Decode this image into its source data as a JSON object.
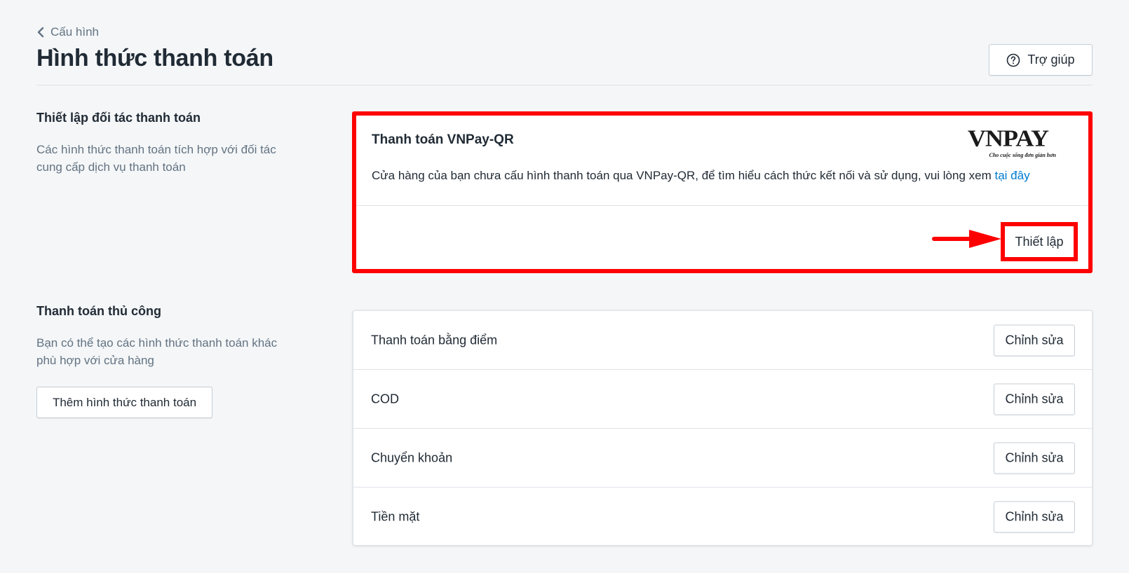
{
  "breadcrumb": {
    "label": "Cấu hình",
    "icon": "chevron-left-icon"
  },
  "page": {
    "title": "Hình thức thanh toán"
  },
  "help_button": {
    "label": "Trợ giúp",
    "icon": "question-circle-icon"
  },
  "partner_section": {
    "title": "Thiết lập đối tác thanh toán",
    "description": "Các hình thức thanh toán tích hợp với đối tác cung cấp dịch vụ thanh toán"
  },
  "vnpay_card": {
    "title": "Thanh toán VNPay-QR",
    "description": "Cửa hàng của bạn chưa cấu hình thanh toán qua VNPay-QR, để tìm hiểu cách thức kết nối và sử dụng, vui lòng xem ",
    "link_label": "tại đây",
    "logo_text": "VNPAY",
    "logo_tagline": "Cho cuộc sống đơn giản hơn",
    "setup_label": "Thiết lập",
    "highlight_color": "#ff0000"
  },
  "manual_section": {
    "title": "Thanh toán thủ công",
    "description": "Bạn có thể tạo các hình thức thanh toán khác phù hợp với cửa hàng",
    "add_button_label": "Thêm hình thức thanh toán"
  },
  "payment_methods": [
    {
      "name": "Thanh toán bằng điểm",
      "edit_label": "Chỉnh sửa"
    },
    {
      "name": "COD",
      "edit_label": "Chỉnh sửa"
    },
    {
      "name": "Chuyển khoản",
      "edit_label": "Chỉnh sửa"
    },
    {
      "name": "Tiền mặt",
      "edit_label": "Chỉnh sửa"
    }
  ],
  "colors": {
    "background": "#f4f6f8",
    "link": "#007ace",
    "text": "#212b35",
    "muted": "#637381",
    "annotation": "#ff0000"
  }
}
